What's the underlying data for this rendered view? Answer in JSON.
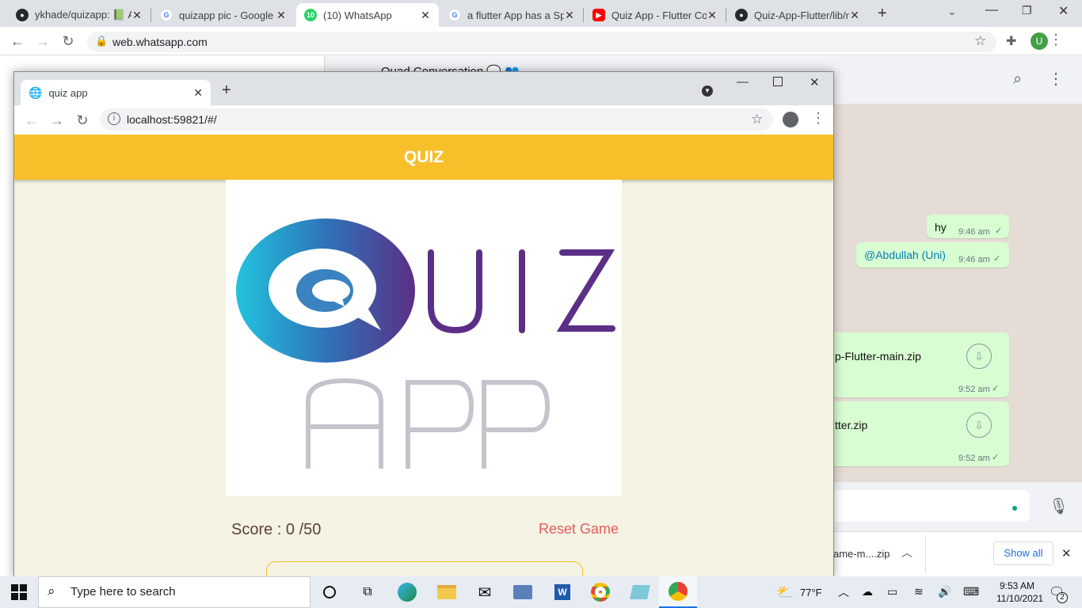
{
  "outer_tabs": [
    {
      "label": "ykhade/quizapp: 📗 A"
    },
    {
      "label": "quizapp pic - Google S"
    },
    {
      "label": "(10) WhatsApp",
      "badge": "10"
    },
    {
      "label": "a flutter App has a Spl"
    },
    {
      "label": "Quiz App - Flutter Co"
    },
    {
      "label": "Quiz-App-Flutter/lib/r"
    }
  ],
  "outer_url": "web.whatsapp.com",
  "profile_initial": "U",
  "whatsapp": {
    "chat_title": "Quad Conversation 🗨️ 👥",
    "messages": [
      {
        "text": "hy",
        "time": "9:46 am"
      },
      {
        "text": "@Abdullah (Uni)",
        "time": "9:46 am"
      },
      {
        "text": "p-Flutter-main.zip",
        "time": "9:52 am"
      },
      {
        "text": "tter.zip",
        "time": "9:52 am"
      }
    ],
    "download_file": "ame-m....zip",
    "show_all": "Show all"
  },
  "inner": {
    "tab_title": "quiz app",
    "url": "localhost:59821/#/",
    "appbar_title": "QUIZ",
    "logo_top": "UIZ",
    "logo_bottom": "APP",
    "score": "Score : 0 /50",
    "reset": "Reset Game"
  },
  "taskbar": {
    "search_placeholder": "Type here to search",
    "weather": "77°F",
    "time": "9:53 AM",
    "date": "11/10/2021",
    "notifications": "2"
  },
  "colors": {
    "appbar": "#f7c02b",
    "page_bg": "#f4f3e4",
    "reset": "#e95a5a",
    "score": "#5d4037"
  }
}
